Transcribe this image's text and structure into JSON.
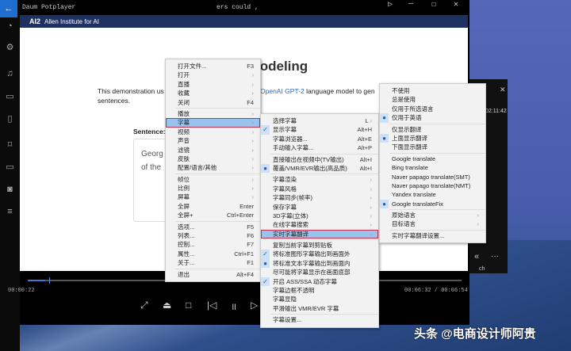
{
  "window": {
    "title": "Daum Potplayer",
    "title_fragment": "ers could ,",
    "time_elapsed": "00:00:22",
    "time_total": "00:06:32 / 00:06:54",
    "panel_time": "02:11:42",
    "panel_label": "ch",
    "progress_percent": 4
  },
  "web": {
    "logo": "AI2",
    "org": "Allen Institute for AI",
    "heading": "lodeling",
    "desc1": "This demonstration us",
    "desc_link": "OpenAI GPT-2",
    "desc2": "language model to gen",
    "desc3": "sentences.",
    "sentence_label": "Sentence:",
    "sentence_1": "Georg",
    "sentence_2": "of the"
  },
  "menu1": [
    {
      "label": "打开文件...",
      "key": "F3"
    },
    {
      "label": "打开",
      "sub": true
    },
    {
      "label": "直播",
      "sub": true
    },
    {
      "label": "收藏",
      "sub": true
    },
    {
      "label": "关闭",
      "key": "F4"
    },
    {
      "sep": true
    },
    {
      "label": "播放",
      "sub": true
    },
    {
      "label": "字幕",
      "sub": true,
      "active": true
    },
    {
      "label": "视频",
      "sub": true
    },
    {
      "label": "声音",
      "sub": true
    },
    {
      "label": "滤镜",
      "sub": true
    },
    {
      "label": "皮肤",
      "sub": true
    },
    {
      "label": "配置/语言/其他",
      "sub": true
    },
    {
      "sep": true
    },
    {
      "label": "帧位",
      "sub": true
    },
    {
      "label": "比例",
      "sub": true
    },
    {
      "label": "屏幕",
      "sub": true
    },
    {
      "label": "全屏",
      "key": "Enter"
    },
    {
      "label": "全屏+",
      "key": "Ctrl+Enter"
    },
    {
      "sep": true
    },
    {
      "label": "选项...",
      "key": "F5"
    },
    {
      "label": "列表...",
      "key": "F6"
    },
    {
      "label": "控制...",
      "key": "F7"
    },
    {
      "label": "属性...",
      "key": "Ctrl+F1"
    },
    {
      "label": "关于...",
      "key": "F1"
    },
    {
      "sep": true
    },
    {
      "label": "退出",
      "key": "Alt+F4"
    }
  ],
  "menu2": [
    {
      "label": "选择字幕",
      "key": "L",
      "sub": true
    },
    {
      "label": "显示字幕",
      "key": "Alt+H",
      "mark": "✓"
    },
    {
      "label": "字幕浏览器...",
      "key": "Alt+E"
    },
    {
      "label": "手动输入字幕...",
      "key": "Alt+P"
    },
    {
      "sep": true
    },
    {
      "label": "直接输出在视频中(TV输出)",
      "key": "Alt+I"
    },
    {
      "label": "覆盖/VMR/EVR输出(高品质)",
      "key": "Alt+I",
      "mark": "●"
    },
    {
      "sep": true
    },
    {
      "label": "字幕渲染",
      "sub": true
    },
    {
      "label": "字幕风格",
      "sub": true
    },
    {
      "label": "字幕同步(帧率)",
      "sub": true
    },
    {
      "label": "保存字幕",
      "sub": true
    },
    {
      "label": "3D字幕(立体)",
      "sub": true
    },
    {
      "label": "在线字幕搜索",
      "sub": true
    },
    {
      "label": "实时字幕翻译",
      "sub": true,
      "active": true
    },
    {
      "sep": true
    },
    {
      "label": "复制当前字幕到剪贴板"
    },
    {
      "label": "将标准图形字幕输出到画面外",
      "mark": "✓"
    },
    {
      "label": "将标准文本字幕输出到画面内",
      "mark": "●"
    },
    {
      "label": "尽可能将字幕显示在画面底部"
    },
    {
      "label": "开启 ASS/SSA 动态字幕",
      "mark": "✓"
    },
    {
      "label": "字幕边框不透明"
    },
    {
      "label": "字幕显隐"
    },
    {
      "label": "平滑输出 VMR/EVR 字幕"
    },
    {
      "sep": true
    },
    {
      "label": "字幕设置..."
    }
  ],
  "menu3": [
    {
      "label": "不使用"
    },
    {
      "label": "总是使用"
    },
    {
      "label": "仅用于所选语言"
    },
    {
      "label": "仅用于英语",
      "mark": "●"
    },
    {
      "sep": true
    },
    {
      "label": "仅显示翻译"
    },
    {
      "label": "上面显示翻译",
      "mark": "●"
    },
    {
      "label": "下面显示翻译"
    },
    {
      "sep": true
    },
    {
      "label": "Google translate"
    },
    {
      "label": "Bing translate"
    },
    {
      "label": "Naver papago translate(SMT)"
    },
    {
      "label": "Naver papago translate(NMT)"
    },
    {
      "label": "Yandex translate"
    },
    {
      "label": "Google translateFix",
      "mark": "●"
    },
    {
      "sep": true
    },
    {
      "label": "原始语言",
      "sub": true
    },
    {
      "label": "目标语言",
      "sub": true
    },
    {
      "sep": true
    },
    {
      "label": "实时字幕翻译设置..."
    }
  ],
  "watermark": "头条 @电商设计师阿贵"
}
